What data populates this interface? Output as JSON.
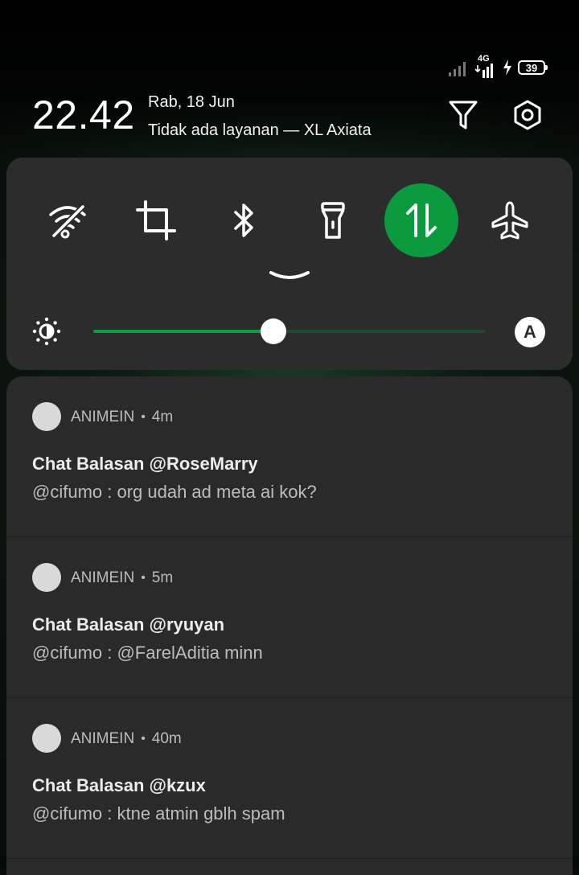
{
  "status_bar": {
    "network_type": "4G",
    "battery_level": "39"
  },
  "header": {
    "time": "22.42",
    "date": "Rab, 18 Jun",
    "network_status": "Tidak ada layanan — XL Axiata"
  },
  "quick_settings": {
    "tiles": [
      {
        "icon": "wifi-off-icon",
        "active": false
      },
      {
        "icon": "screenshot-crop-icon",
        "active": false
      },
      {
        "icon": "bluetooth-icon",
        "active": false
      },
      {
        "icon": "flashlight-icon",
        "active": false
      },
      {
        "icon": "mobile-data-icon",
        "active": true
      },
      {
        "icon": "airplane-icon",
        "active": false
      }
    ],
    "brightness_fraction": 0.46,
    "auto_brightness_label": "A"
  },
  "notifications": [
    {
      "app": "ANIMEIN",
      "time": "4m",
      "title": "Chat Balasan @RoseMarry",
      "text": "@cifumo : org udah ad meta ai kok?"
    },
    {
      "app": "ANIMEIN",
      "time": "5m",
      "title": "Chat Balasan @ryuyan",
      "text": "@cifumo : @FarelAditia minn"
    },
    {
      "app": "ANIMEIN",
      "time": "40m",
      "title": "Chat Balasan @kzux",
      "text": "@cifumo : ktne atmin gblh spam"
    }
  ],
  "colors": {
    "accent": "#0b9a3e",
    "panel": "#2c2c2c",
    "notification_bg": "#2a2a2a"
  }
}
